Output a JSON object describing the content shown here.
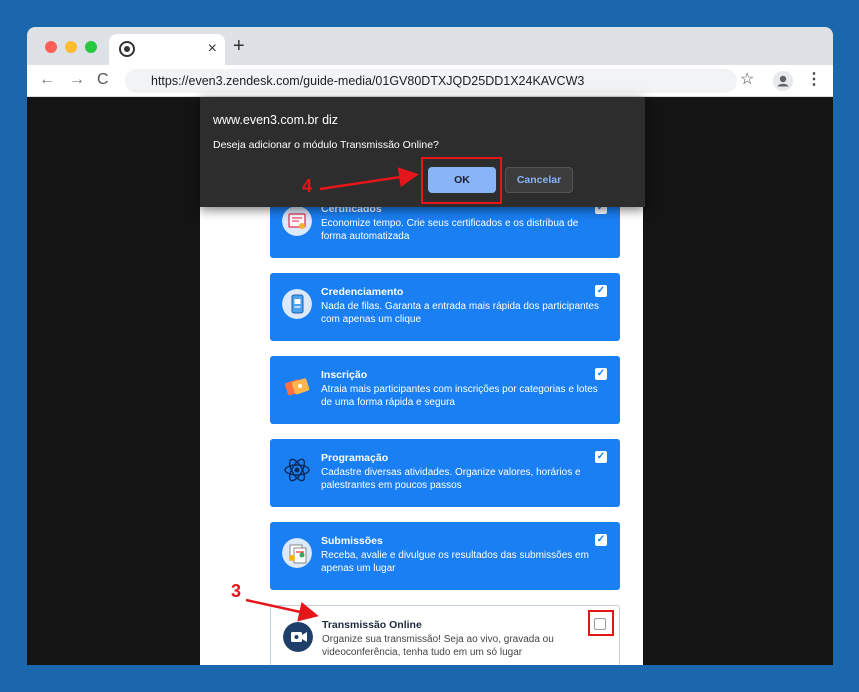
{
  "browser": {
    "url": "https://even3.zendesk.com/guide-media/01GV80DTXJQD25DD1X24KAVCW3",
    "tab_close": "×",
    "new_tab": "+",
    "nav_back": "←",
    "nav_forward": "→",
    "nav_reload": "C",
    "star": "☆",
    "menu": "⋮"
  },
  "dialog": {
    "origin": "www.even3.com.br diz",
    "message": "Deseja adicionar o módulo Transmissão Online?",
    "ok_label": "OK",
    "cancel_label": "Cancelar"
  },
  "modules": [
    {
      "title": "Certificados",
      "desc": "Economize tempo. Crie seus certificados e os distribua de forma automatizada",
      "checked": true,
      "check_mark": "✓",
      "icon": "certificate-icon"
    },
    {
      "title": "Credenciamento",
      "desc": "Nada de filas. Garanta a entrada mais rápida dos participantes com apenas um clique",
      "checked": true,
      "check_mark": "✓",
      "icon": "badge-icon"
    },
    {
      "title": "Inscrição",
      "desc": "Atraia mais participantes com inscrições por categorias e lotes de uma forma rápida e segura",
      "checked": true,
      "check_mark": "✓",
      "icon": "ticket-icon"
    },
    {
      "title": "Programação",
      "desc": "Cadastre diversas atividades. Organize valores, horários e palestrantes em poucos passos",
      "checked": true,
      "check_mark": "✓",
      "icon": "atom-icon"
    },
    {
      "title": "Submissões",
      "desc": "Receba, avalie e divulgue os resultados das submissões em apenas um lugar",
      "checked": true,
      "check_mark": "✓",
      "icon": "documents-icon"
    },
    {
      "title": "Transmissão Online",
      "desc": "Organize sua transmissão! Seja ao vivo, gravada ou videoconferência, tenha tudo em um só lugar",
      "checked": false,
      "check_mark": "",
      "icon": "video-camera-icon"
    }
  ],
  "annotations": {
    "step3": "3",
    "step4": "4"
  },
  "colors": {
    "background": "#1b67ad",
    "card_blue": "#1a7ff3",
    "annotation_red": "#e5161a",
    "ok_button": "#8ab4f8"
  }
}
